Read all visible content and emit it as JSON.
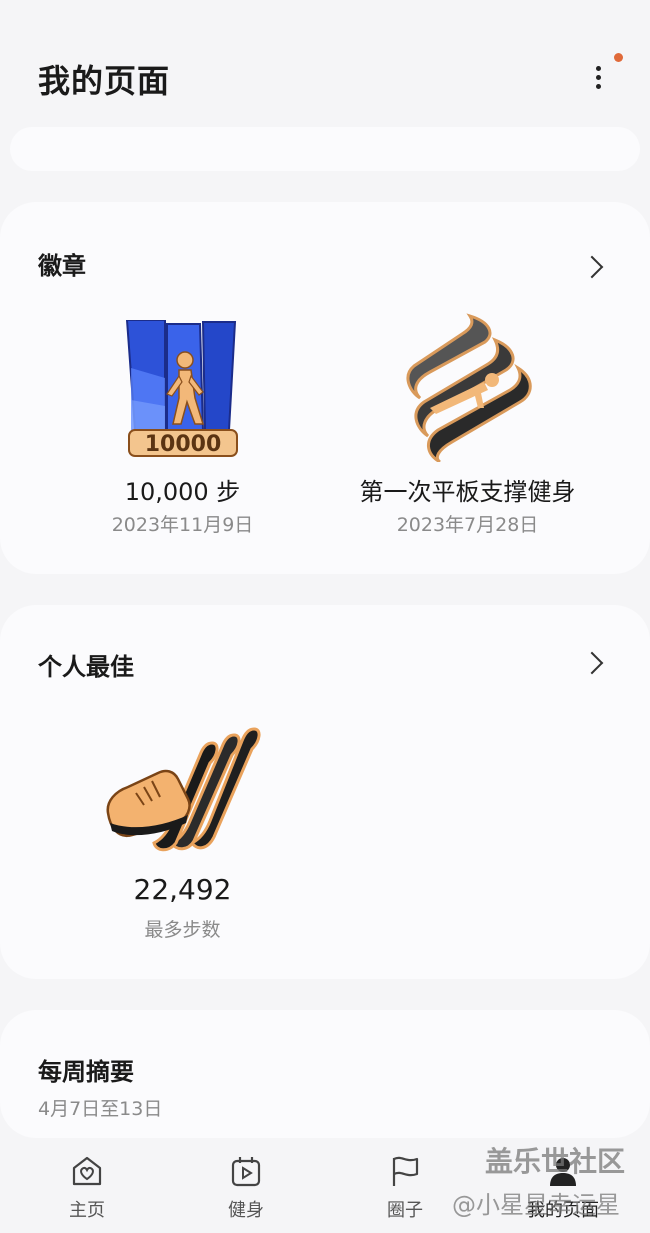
{
  "header": {
    "title": "我的页面"
  },
  "badges": {
    "title": "徽章",
    "items": [
      {
        "name": "10,000 步",
        "date": "2023年11月9日",
        "icon": "walking-badge-icon"
      },
      {
        "name": "第一次平板支撑健身",
        "date": "2023年7月28日",
        "icon": "plank-badge-icon"
      }
    ]
  },
  "personal_best": {
    "title": "个人最佳",
    "value": "22,492",
    "label": "最多步数",
    "icon": "shoe-badge-icon"
  },
  "weekly": {
    "title": "每周摘要",
    "range": "4月7日至13日"
  },
  "nav": {
    "items": [
      {
        "label": "主页",
        "icon": "home-heart-icon"
      },
      {
        "label": "健身",
        "icon": "workout-play-icon"
      },
      {
        "label": "圈子",
        "icon": "flag-icon"
      },
      {
        "label": "我的页面",
        "icon": "profile-icon"
      }
    ]
  },
  "watermark": {
    "line1": "盖乐世社区",
    "line2": "@小星星幸运星"
  },
  "colors": {
    "accent_dot": "#e06a3a",
    "badge_blue": "#2a4fd6",
    "badge_gold": "#e9a25c"
  }
}
